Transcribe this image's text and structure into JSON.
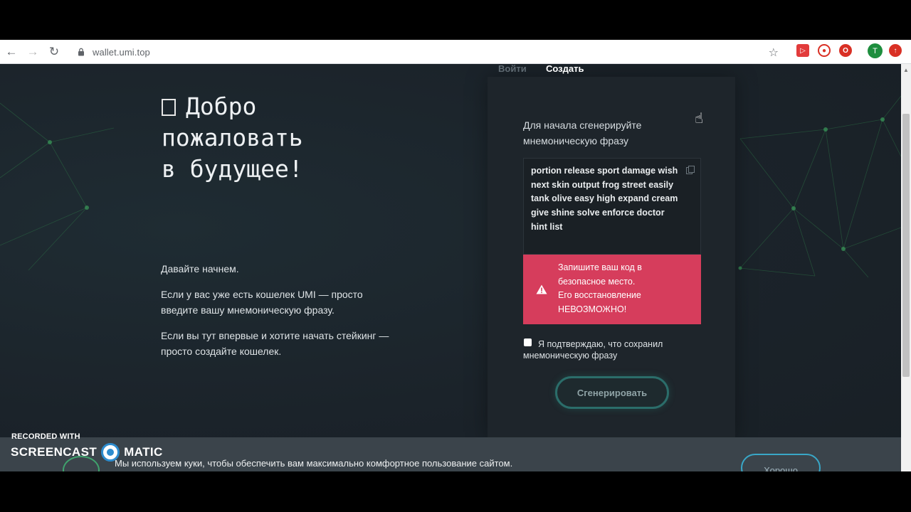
{
  "browser": {
    "url": "wallet.umi.top",
    "profile_initial": "T"
  },
  "tabs": {
    "login": "Войти",
    "create": "Создать"
  },
  "welcome": {
    "title_line1": "Добро",
    "title_line2": "пожаловать",
    "title_line3": "в будущее!",
    "p1": "Давайте начнем.",
    "p2": "Если у вас уже есть кошелек UMI — просто введите вашу мнемоническую фразу.",
    "p3": "Если вы тут впервые и хотите начать стейкинг — просто создайте кошелек."
  },
  "card": {
    "heading": "Для начала сгенерируйте мнемоническую фразу",
    "phrase": "portion release sport damage wish next skin output frog street easily tank olive easy high expand cream give shine solve enforce doctor hint list",
    "warning_line1": "Запишите ваш код в",
    "warning_line2": "безопасное место.",
    "warning_line3": "Его восстановление",
    "warning_line4": "НЕВОЗМОЖНО!",
    "confirm_label": "Я подтверждаю, что сохранил мнемоническую фразу",
    "generate_button": "Сгенерировать"
  },
  "cookie": {
    "text": "Мы используем куки, чтобы обеспечить вам максимально комфортное пользование сайтом.",
    "button": "Хорошо"
  },
  "watermark": {
    "recorded": "RECORDED WITH",
    "brand_left": "SCREENCAST",
    "brand_right": "MATIC"
  },
  "colors": {
    "accent_teal": "#2b6d6a",
    "warning_red": "#d63d5c",
    "page_bg": "#1b232a"
  }
}
